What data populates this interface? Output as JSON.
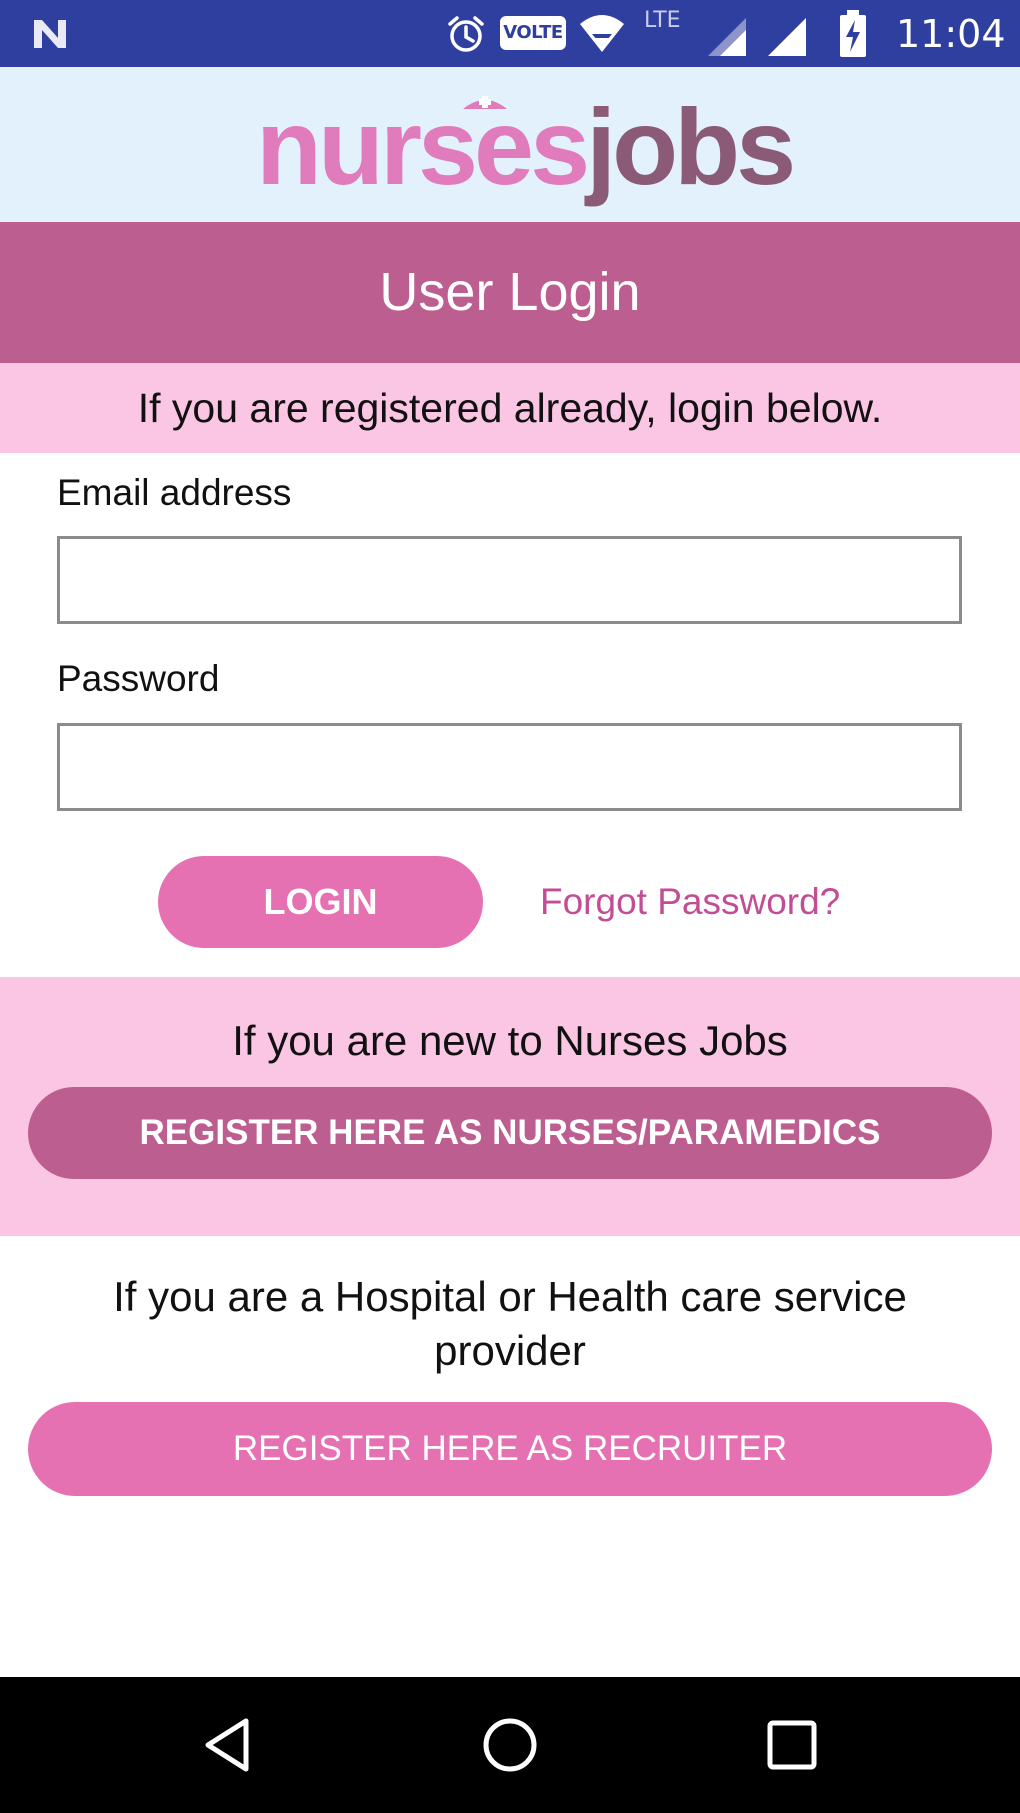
{
  "status_bar": {
    "time": "11:04",
    "volte": "VOLTE",
    "network": "LTE"
  },
  "logo": {
    "part_a": "nurses",
    "part_b": "jobs",
    "colors": {
      "primary": "#e07bbc",
      "secondary": "#8a5a76"
    }
  },
  "header": {
    "title": "User Login"
  },
  "login": {
    "notice": "If you are registered already, login below.",
    "email_label": "Email address",
    "email_value": "",
    "password_label": "Password",
    "password_value": "",
    "login_button": "LOGIN",
    "forgot_link": "Forgot Password?"
  },
  "new_user": {
    "text": "If you are new to Nurses Jobs",
    "register_button": "REGISTER HERE AS NURSES/PARAMEDICS"
  },
  "recruiter": {
    "text": "If you are a Hospital or Health care service provider",
    "register_button": "REGISTER HERE AS RECRUITER"
  },
  "nav": {
    "icons": [
      "back-triangle-icon",
      "home-circle-icon",
      "recents-square-icon"
    ]
  },
  "colors": {
    "status_bar": "#2f3f9f",
    "logo_bg": "#e3f1fd",
    "title_band": "#bd5e90",
    "light_band": "#fbc5e4",
    "pink_button": "#e571b3",
    "link": "#c24d95"
  }
}
